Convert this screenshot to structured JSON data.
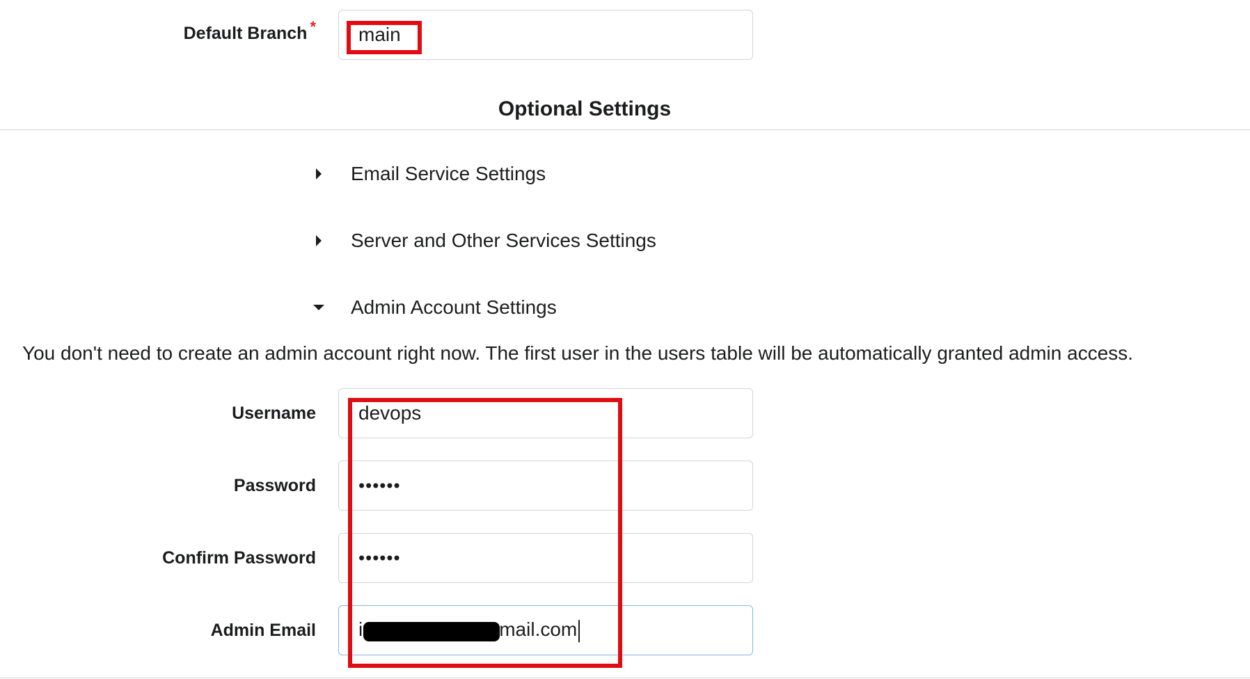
{
  "repo": {
    "default_branch_label": "Default Branch",
    "required_mark": "*",
    "default_branch_value": "main"
  },
  "optional_settings": {
    "title": "Optional Settings",
    "sections": [
      {
        "label": "Email Service Settings",
        "expanded": false,
        "icon": "caret-right-icon"
      },
      {
        "label": "Server and Other Services Settings",
        "expanded": false,
        "icon": "caret-right-icon"
      },
      {
        "label": "Admin Account Settings",
        "expanded": true,
        "icon": "caret-down-icon"
      }
    ]
  },
  "admin": {
    "info_text": "You don't need to create an admin account right now. The first user in the users table will be automatically granted admin access.",
    "username_label": "Username",
    "username_value": "devops",
    "password_label": "Password",
    "password_value": "••••••",
    "confirm_password_label": "Confirm Password",
    "confirm_password_value": "••••••",
    "email_label": "Admin Email",
    "email_prefix": "i",
    "email_suffix": "mail.com"
  },
  "colors": {
    "highlight": "#e10c12",
    "focused_border": "#85b7d9",
    "required": "#db2828"
  }
}
